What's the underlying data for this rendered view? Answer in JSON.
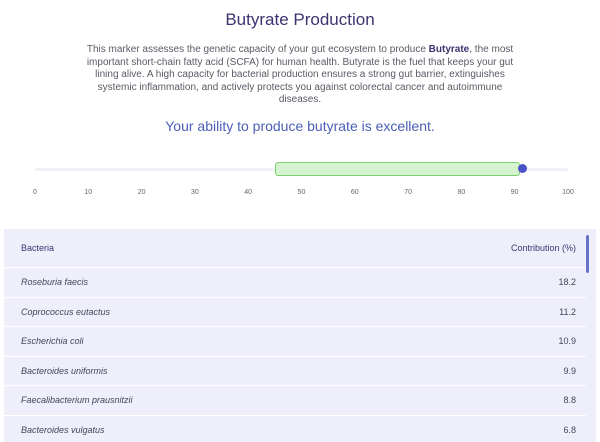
{
  "header": {
    "title": "Butyrate Production",
    "description_pre": "This marker assesses the genetic capacity of your gut ecosystem to produce ",
    "description_bold": "Butyrate",
    "description_post": ", the most important short-chain fatty acid (SCFA) for human health. Butyrate is the fuel that keeps your gut lining alive. A high capacity for bacterial production ensures a strong gut barrier, extinguishes systemic inflammation, and actively protects you against colorectal cancer and autoimmune diseases.",
    "verdict": "Your ability to produce butyrate is excellent."
  },
  "scale": {
    "min": 0,
    "max": 100,
    "ticks": [
      "0",
      "10",
      "20",
      "30",
      "40",
      "50",
      "60",
      "70",
      "80",
      "90",
      "100"
    ],
    "range_low": 45,
    "range_high": 91,
    "value": 91.5,
    "range_color": "#d6f3cf",
    "marker_color": "#4a52c9"
  },
  "table": {
    "col_bacteria": "Bacteria",
    "col_contribution": "Contribution (%)",
    "rows": [
      {
        "name": "Roseburia faecis",
        "value": "18.2"
      },
      {
        "name": "Coprococcus eutactus",
        "value": "11.2"
      },
      {
        "name": "Escherichia coli",
        "value": "10.9"
      },
      {
        "name": "Bacteroides uniformis",
        "value": "9.9"
      },
      {
        "name": "Faecalibacterium prausnitzii",
        "value": "8.8"
      },
      {
        "name": "Bacteroides vulgatus",
        "value": "6.8"
      }
    ]
  },
  "colors": {
    "title": "#3b3470",
    "verdict": "#4a5fb5",
    "table_bg": "#eeeffa"
  }
}
